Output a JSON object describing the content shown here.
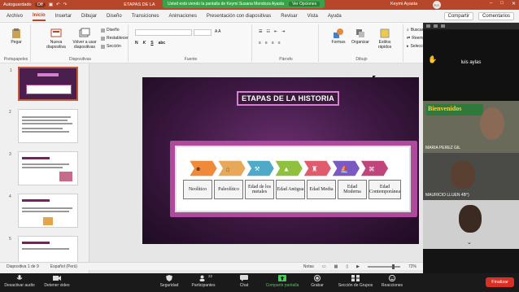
{
  "titlebar": {
    "autosave_label": "Autoguardado",
    "toggle_state": "Off",
    "doc_title": "ETAPAS DE LA",
    "share_banner": "Usted está viendo la pantalla de  Keymi Susana Mendoza Ayasta",
    "share_options": "Ver Opciones",
    "user_name": "Keymi Ayasta",
    "user_initials": "KA"
  },
  "tabs": {
    "items": [
      "Archivo",
      "Inicio",
      "Insertar",
      "Dibujar",
      "Diseño",
      "Transiciones",
      "Animaciones",
      "Presentación con diapositivas",
      "Revisar",
      "Vista",
      "Ayuda"
    ],
    "active": "Inicio",
    "share": "Compartir",
    "comments": "Comentarios"
  },
  "ribbon": {
    "paste": "Pegar",
    "clipboard": "Portapapeles",
    "new_slide": "Nueva diapositiva",
    "reuse_slides": "Volver a usar diapositivas",
    "design": "Diseño",
    "reset": "Restablecer",
    "section": "Sección",
    "slides_group": "Diapositivas",
    "font_group": "Fuente",
    "paragraph_group": "Párrafo",
    "shapes": "Formas",
    "arrange": "Organizar",
    "quick_styles": "Estilos rápidos",
    "drawing_group": "Dibujo",
    "find": "Buscar",
    "replace": "Reemplazar",
    "select": "Seleccionar"
  },
  "slide": {
    "title": "ETAPAS DE LA HISTORIA",
    "eras": [
      "Neolítico",
      "Paleolítico",
      "Edad de los metales",
      "Edad Antigua",
      "Edad Media",
      "Edad Moderna",
      "Edad Contemporánea"
    ]
  },
  "thumbnails": [
    "1",
    "2",
    "3",
    "4",
    "5"
  ],
  "zoom": {
    "participants": [
      {
        "name": "luis aylas"
      },
      {
        "name": "MARIA PEREZ GIL",
        "banner": "Bienvenidos"
      },
      {
        "name": "MAURICIO LLUEN 4B°)"
      },
      {
        "name": ""
      }
    ]
  },
  "statusbar": {
    "slide_info": "Diapositiva 1 de 9",
    "language": "Español (Perú)",
    "notes": "Notas",
    "zoom": "72%"
  },
  "zoom_toolbar": {
    "items": [
      "Desactivar audio",
      "Detener video",
      "Seguridad",
      "Participantes",
      "Chat",
      "Compartir pantalla",
      "Grabar",
      "Sección de Grupos",
      "Reacciones"
    ],
    "participants_count": "22",
    "end": "Finalizar"
  },
  "colors": {
    "accent": "#b7472a",
    "slide_purple": "#6a2f6f",
    "zoom_green": "#49c95a",
    "end_red": "#d93025"
  }
}
